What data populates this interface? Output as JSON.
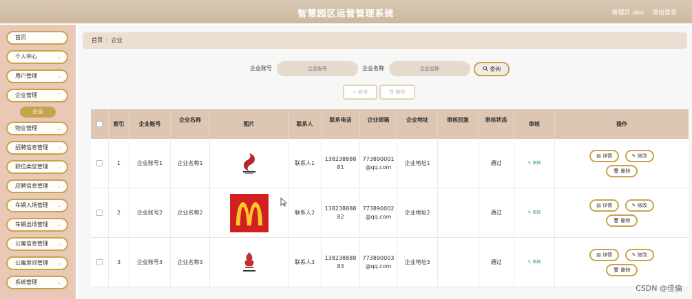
{
  "header": {
    "title": "智慧园区运营管理系统",
    "user": "管理员 abo",
    "logout": "退出登录"
  },
  "sidebar": {
    "items": [
      {
        "label": "首页",
        "chevron": ""
      },
      {
        "label": "个人中心",
        "chevron": "⌄"
      },
      {
        "label": "用户管理",
        "chevron": "⌄"
      },
      {
        "label": "企业管理",
        "chevron": "⌃"
      },
      {
        "label": "物业管理",
        "chevron": "⌄"
      },
      {
        "label": "招聘信息管理",
        "chevron": "⌄"
      },
      {
        "label": "职位类型管理",
        "chevron": "⌄"
      },
      {
        "label": "应聘信息管理",
        "chevron": "⌄"
      },
      {
        "label": "车辆入场管理",
        "chevron": "⌄"
      },
      {
        "label": "车辆出场管理",
        "chevron": "⌄"
      },
      {
        "label": "公寓信息管理",
        "chevron": "⌄"
      },
      {
        "label": "公寓房间管理",
        "chevron": "⌄"
      },
      {
        "label": "系统管理",
        "chevron": "⌄"
      }
    ],
    "active_sub": "企业"
  },
  "breadcrumb": {
    "home": "首页",
    "sep": "/",
    "current": "企业"
  },
  "search": {
    "account_label": "企业账号",
    "account_placeholder": "企业账号",
    "name_label": "企业名称",
    "name_placeholder": "企业名称",
    "query_label": "查询",
    "query_icon": "search-icon"
  },
  "actions": {
    "add": "+ 新增",
    "delete": "删除"
  },
  "table": {
    "sort_glyph": "⇕",
    "headers": {
      "index": "索引",
      "account": "企业账号",
      "name": "企业名称",
      "image": "图片",
      "contact": "联系人",
      "phone": "联系电话",
      "email": "企业邮箱",
      "address": "企业地址",
      "reply": "审核回复",
      "status": "审核状态",
      "review": "审核",
      "ops": "操作"
    },
    "rows": [
      {
        "index": "1",
        "account": "企业账号1",
        "name": "企业名称1",
        "logo": "brand-logo-1",
        "contact": "联系人1",
        "phone_a": "138238888",
        "phone_b": "81",
        "email_a": "773890001",
        "email_b": "@qq.com",
        "address": "企业地址1",
        "reply": "",
        "status": "通过",
        "review": "审核"
      },
      {
        "index": "2",
        "account": "企业账号2",
        "name": "企业名称2",
        "logo": "mcdonalds-logo",
        "contact": "联系人2",
        "phone_a": "138238888",
        "phone_b": "82",
        "email_a": "773890002",
        "email_b": "@qq.com",
        "address": "企业地址2",
        "reply": "",
        "status": "通过",
        "review": "审核"
      },
      {
        "index": "3",
        "account": "企业账号3",
        "name": "企业名称3",
        "logo": "brand-logo-3",
        "contact": "联系人3",
        "phone_a": "138238888",
        "phone_b": "83",
        "email_a": "773890003",
        "email_b": "@qq.com",
        "address": "企业地址3",
        "reply": "",
        "status": "通过",
        "review": "审核"
      }
    ],
    "ops": {
      "detail": "详情",
      "edit": "修改",
      "delete": "删除"
    }
  },
  "watermark": "CSDN @佳倫",
  "colors": {
    "accent": "#c9a24d",
    "header": "#cdb89e",
    "sidebar": "#e9c9b5",
    "table_head": "#ddc7b2"
  }
}
